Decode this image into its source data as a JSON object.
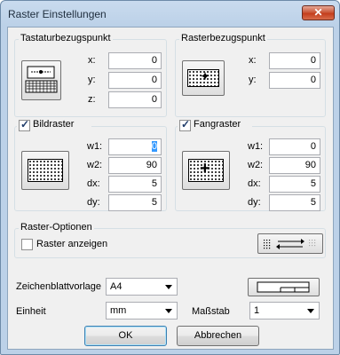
{
  "window": {
    "title": "Raster Einstellungen",
    "close_glyph": "✕"
  },
  "tastatur": {
    "label": "Tastaturbezugspunkt",
    "x_label": "x:",
    "x_value": "0",
    "y_label": "y:",
    "y_value": "0",
    "z_label": "z:",
    "z_value": "0"
  },
  "rasterbezug": {
    "label": "Rasterbezugspunkt",
    "x_label": "x:",
    "x_value": "0",
    "y_label": "y:",
    "y_value": "0"
  },
  "bildraster": {
    "label": "Bildraster",
    "checked": true,
    "w1_label": "w1:",
    "w1_value": "0",
    "w2_label": "w2:",
    "w2_value": "90",
    "dx_label": "dx:",
    "dx_value": "5",
    "dy_label": "dy:",
    "dy_value": "5"
  },
  "fangraster": {
    "label": "Fangraster",
    "checked": true,
    "w1_label": "w1:",
    "w1_value": "0",
    "w2_label": "w2:",
    "w2_value": "90",
    "dx_label": "dx:",
    "dx_value": "5",
    "dy_label": "dy:",
    "dy_value": "5"
  },
  "options": {
    "label": "Raster-Optionen",
    "show_grid_label": "Raster anzeigen",
    "show_grid_checked": false
  },
  "zeichenblatt": {
    "label": "Zeichenblattvorlage",
    "value": "A4"
  },
  "einheit": {
    "label": "Einheit",
    "value": "mm"
  },
  "massstab": {
    "label": "Maßstab",
    "value": "1"
  },
  "buttons": {
    "ok": "OK",
    "cancel": "Abbrechen"
  },
  "colors": {
    "title_bar": "#bcd1e8",
    "close_button": "#c43e1d",
    "client_bg": "#f0f0f0",
    "check_mark": "#1f3c6a"
  }
}
